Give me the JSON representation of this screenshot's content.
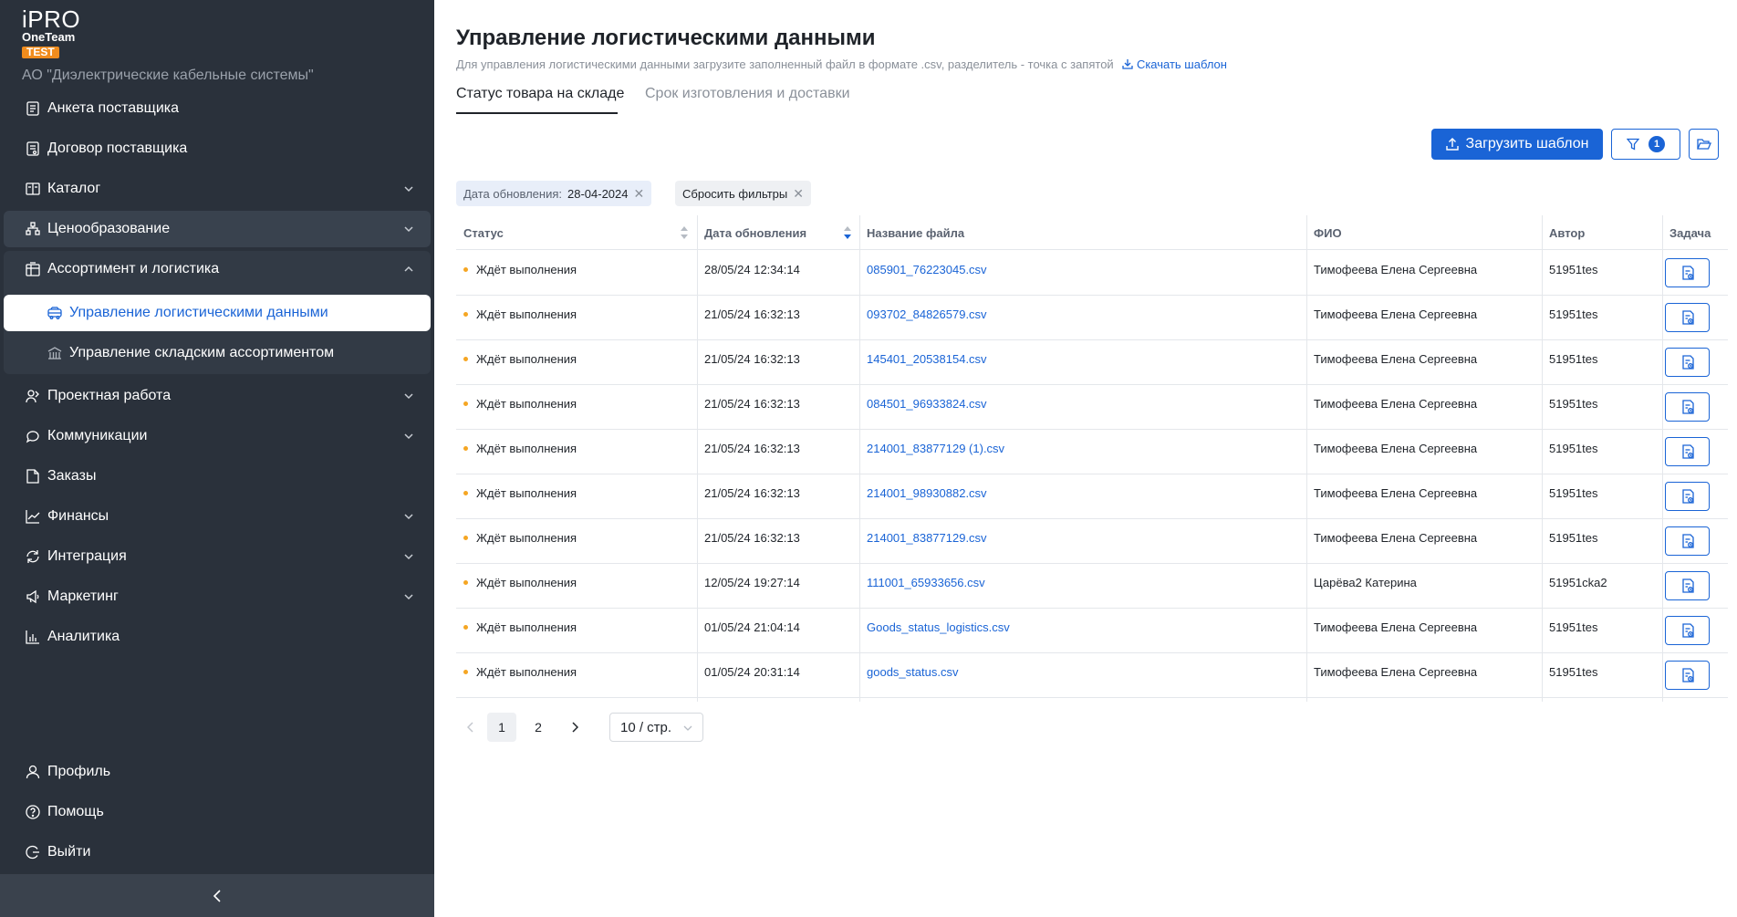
{
  "brand": {
    "name": "iPRO",
    "product": "OneTeam",
    "env": "TEST"
  },
  "company": "АО \"Диэлектрические кабельные системы\"",
  "sidebar": {
    "items": [
      {
        "label": "Анкета поставщика",
        "icon": "document-icon"
      },
      {
        "label": "Договор поставщика",
        "icon": "contract-icon"
      },
      {
        "label": "Каталог",
        "icon": "catalog-icon"
      },
      {
        "label": "Ценообразование",
        "icon": "pricing-icon"
      },
      {
        "label": "Ассортимент и логистика",
        "icon": "assortment-icon"
      },
      {
        "label": "Проектная работа",
        "icon": "project-icon"
      },
      {
        "label": "Коммуникации",
        "icon": "chat-icon"
      },
      {
        "label": "Заказы",
        "icon": "orders-icon"
      },
      {
        "label": "Финансы",
        "icon": "finance-icon"
      },
      {
        "label": "Интеграция",
        "icon": "sync-icon"
      },
      {
        "label": "Маркетинг",
        "icon": "megaphone-icon"
      },
      {
        "label": "Аналитика",
        "icon": "analytics-icon"
      }
    ],
    "subitems": [
      {
        "label": "Управление логистическими данными",
        "icon": "truck-icon"
      },
      {
        "label": "Управление складским ассортиментом",
        "icon": "warehouse-icon"
      }
    ],
    "bottom": [
      {
        "label": "Профиль",
        "icon": "user-icon"
      },
      {
        "label": "Помощь",
        "icon": "help-icon"
      },
      {
        "label": "Выйти",
        "icon": "logout-icon"
      }
    ]
  },
  "page": {
    "title": "Управление логистическими данными",
    "description": "Для управления логистическими данными загрузите заполненный файл в формате .csv, разделитель - точка с запятой",
    "download_link": "Скачать шаблон",
    "tabs": [
      "Статус товара на складе",
      "Срок изготовления и доставки"
    ]
  },
  "toolbar": {
    "upload_label": "Загрузить шаблон",
    "filter_count": "1"
  },
  "filters": {
    "date_label": "Дата обновления:",
    "date_value": "28-04-2024",
    "reset_label": "Сбросить фильтры"
  },
  "table": {
    "headers": [
      "Статус",
      "Дата обновления",
      "Название файла",
      "ФИО",
      "Автор",
      "Задача"
    ],
    "rows": [
      {
        "status": "Ждёт выполнения",
        "date": "28/05/24 12:34:14",
        "file": "085901_76223045.csv",
        "fio": "Тимофеева Елена Сергеевна",
        "author": "51951tes"
      },
      {
        "status": "Ждёт выполнения",
        "date": "21/05/24 16:32:13",
        "file": "093702_84826579.csv",
        "fio": "Тимофеева Елена Сергеевна",
        "author": "51951tes"
      },
      {
        "status": "Ждёт выполнения",
        "date": "21/05/24 16:32:13",
        "file": "145401_20538154.csv",
        "fio": "Тимофеева Елена Сергеевна",
        "author": "51951tes"
      },
      {
        "status": "Ждёт выполнения",
        "date": "21/05/24 16:32:13",
        "file": "084501_96933824.csv",
        "fio": "Тимофеева Елена Сергеевна",
        "author": "51951tes"
      },
      {
        "status": "Ждёт выполнения",
        "date": "21/05/24 16:32:13",
        "file": "214001_83877129 (1).csv",
        "fio": "Тимофеева Елена Сергеевна",
        "author": "51951tes"
      },
      {
        "status": "Ждёт выполнения",
        "date": "21/05/24 16:32:13",
        "file": "214001_98930882.csv",
        "fio": "Тимофеева Елена Сергеевна",
        "author": "51951tes"
      },
      {
        "status": "Ждёт выполнения",
        "date": "21/05/24 16:32:13",
        "file": "214001_83877129.csv",
        "fio": "Тимофеева Елена Сергеевна",
        "author": "51951tes"
      },
      {
        "status": "Ждёт выполнения",
        "date": "12/05/24 19:27:14",
        "file": "111001_65933656.csv",
        "fio": "Царёва2 Катерина",
        "author": "51951cka2"
      },
      {
        "status": "Ждёт выполнения",
        "date": "01/05/24 21:04:14",
        "file": "Goods_status_logistics.csv",
        "fio": "Тимофеева Елена Сергеевна",
        "author": "51951tes"
      },
      {
        "status": "Ждёт выполнения",
        "date": "01/05/24 20:31:14",
        "file": "goods_status.csv",
        "fio": "Тимофеева Елена Сергеевна",
        "author": "51951tes"
      }
    ]
  },
  "pagination": {
    "pages": [
      "1",
      "2"
    ],
    "current": "1",
    "page_size": "10 / стр."
  },
  "colors": {
    "sidebar_bg": "#2a313b",
    "accent": "#1a64d6",
    "status_pending": "#f5a623"
  }
}
